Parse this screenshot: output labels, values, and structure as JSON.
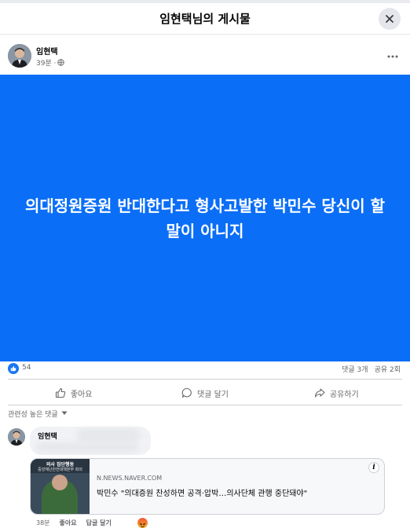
{
  "header": {
    "title": "임현택님의 게시물"
  },
  "post": {
    "author": "임현택",
    "time": "39분 ·",
    "text": "의대정원증원 반대한다고 형사고발한 박민수 당신이 할 말이 아니지",
    "background_color": "#0a6ef7"
  },
  "stats": {
    "likes": "54",
    "comments": "댓글 3개",
    "shares": "공유 2회"
  },
  "actions": {
    "like": "좋아요",
    "comment": "댓글 달기",
    "share": "공유하기"
  },
  "comments_sort": {
    "label": "관련성 높은 댓글"
  },
  "comment": {
    "author": "임현택",
    "link": {
      "domain": "N.NEWS.NAVER.COM",
      "title": "박민수 \"의대증원 찬성하면 공격·압박…의사단체 관행 중단돼야\"",
      "thumb_line1": "의사 집단행동",
      "thumb_line2": "중앙재난안전대책본부 회의"
    },
    "time": "38분",
    "like": "좋아요",
    "reply": "답글 달기"
  },
  "icons": {
    "close": "close-icon",
    "more": "more-icon",
    "globe": "globe-icon",
    "like": "thumbs-up-icon",
    "comment": "comment-bubble-icon",
    "share": "share-arrow-icon",
    "info": "info-icon",
    "angry": "angry-reaction-icon"
  },
  "colors": {
    "brand_blue": "#1877f2",
    "secondary_text": "#65676b"
  }
}
